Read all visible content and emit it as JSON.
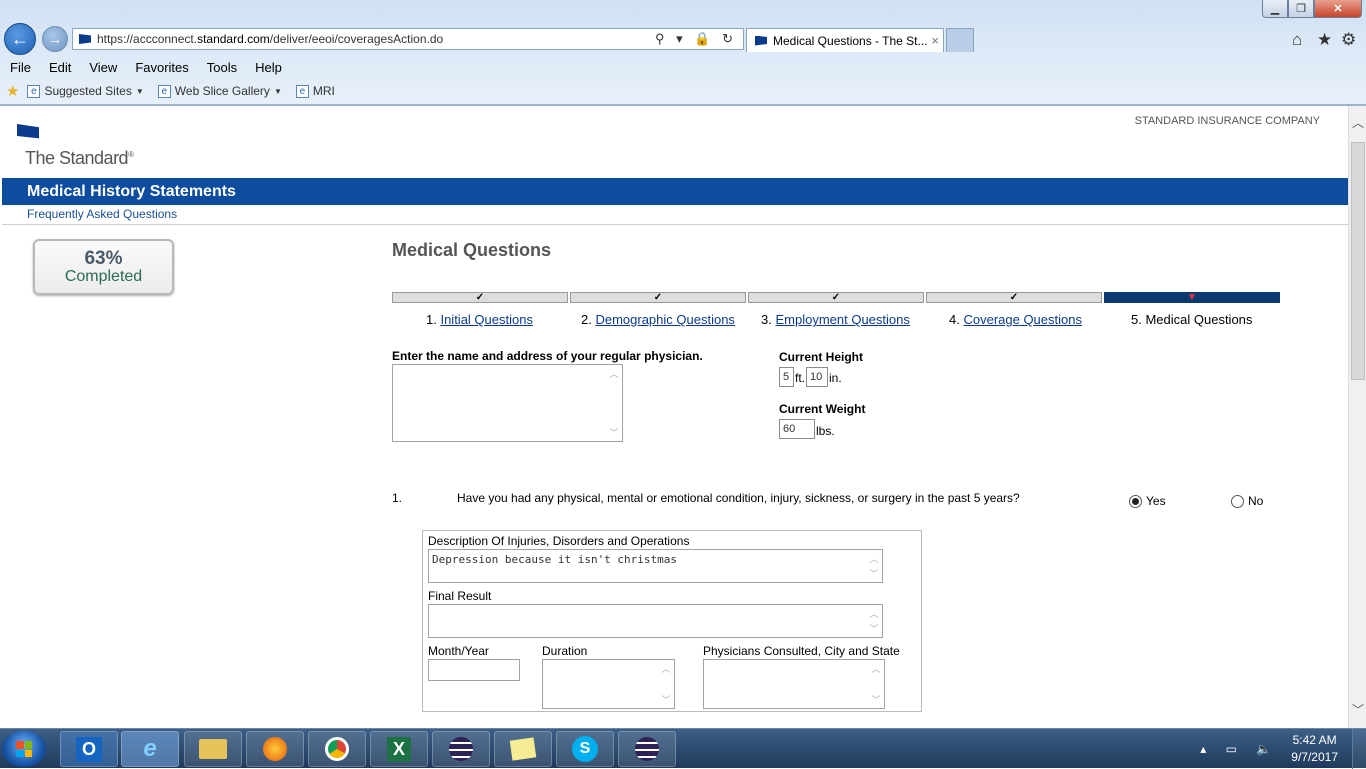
{
  "browser": {
    "url_prefix": "https://accconnect.",
    "url_domain": "standard.com",
    "url_path": "/deliver/eeoi/coveragesAction.do",
    "tab_title": "Medical Questions - The St...",
    "tab_close": "×",
    "address_icons": "⚲ ▾ 🔒 ↻",
    "menu": [
      "File",
      "Edit",
      "View",
      "Favorites",
      "Tools",
      "Help"
    ],
    "favorites": [
      {
        "label": "Suggested Sites",
        "has_caret": true
      },
      {
        "label": "Web Slice Gallery",
        "has_caret": true
      },
      {
        "label": "MRI",
        "has_caret": false
      }
    ],
    "icons": {
      "home": "⌂",
      "star": "★",
      "gear": "⚙"
    }
  },
  "page": {
    "company": "STANDARD INSURANCE COMPANY",
    "logo_text": "The Standard",
    "logo_mark": "®",
    "banner_title": "Medical History Statements",
    "faq_link": "Frequently Asked Questions",
    "progress": {
      "percent_text": "63%",
      "label": "Completed",
      "value": 0.63
    },
    "section_title": "Medical Questions",
    "steps": [
      {
        "num": "1.",
        "label": "Initial Questions",
        "done": true,
        "link": true
      },
      {
        "num": "2.",
        "label": "Demographic Questions",
        "done": true,
        "link": true
      },
      {
        "num": "3.",
        "label": "Employment Questions",
        "done": true,
        "link": true
      },
      {
        "num": "4.",
        "label": "Coverage Questions",
        "done": true,
        "link": true
      },
      {
        "num": "5.",
        "label": "Medical Questions",
        "done": false,
        "link": false
      }
    ],
    "physician_label": "Enter the name and address of your regular physician.",
    "physician_value": "",
    "height_label": "Current Height",
    "height_ft": "5",
    "height_in": "10",
    "ft_unit": "ft.",
    "in_unit": "in.",
    "weight_label": "Current Weight",
    "weight_value": "60",
    "weight_unit": "lbs.",
    "question1": {
      "number": "1.",
      "text": "Have you had any physical, mental or emotional condition, injury, sickness, or surgery in the past 5 years?",
      "yes_label": "Yes",
      "no_label": "No",
      "selected": "Yes"
    },
    "details": {
      "desc_label": "Description Of Injuries, Disorders and Operations",
      "desc_value": "Depression because it isn't christmas",
      "final_label": "Final Result",
      "final_value": "",
      "month_label": "Month/Year",
      "month_value": "",
      "duration_label": "Duration",
      "duration_value": "",
      "physicians_label": "Physicians Consulted, City and State",
      "physicians_value": ""
    }
  },
  "taskbar": {
    "time": "5:42 AM",
    "date": "9/7/2017",
    "apps": [
      "outlook",
      "internet-explorer",
      "file-explorer",
      "firefox",
      "chrome",
      "excel",
      "eclipse",
      "sticky-notes",
      "skype",
      "eclipse"
    ]
  }
}
